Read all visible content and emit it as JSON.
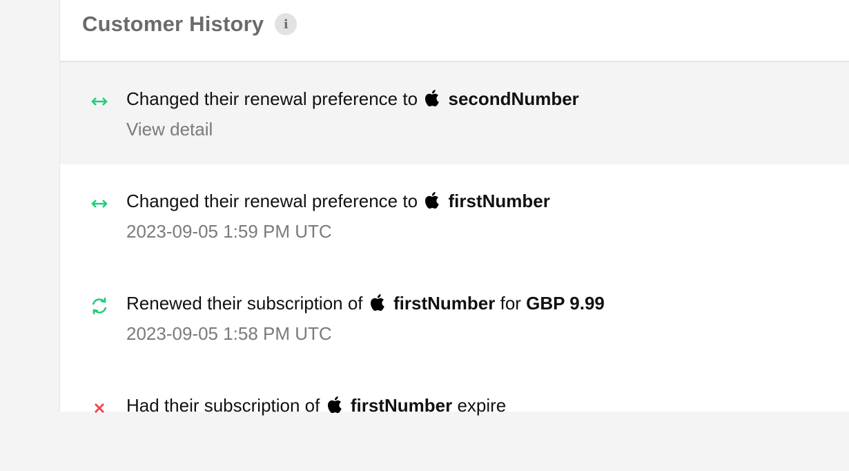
{
  "header": {
    "title": "Customer History",
    "info_glyph": "i"
  },
  "colors": {
    "green": "#1fce7a",
    "red": "#e8464e",
    "selected_bg": "#f4f4f4"
  },
  "events": [
    {
      "icon": "swap-horizontal-icon",
      "prefix": "Changed their renewal preference to",
      "product": "secondNumber",
      "suffix": "",
      "sub": "View detail",
      "selected": true
    },
    {
      "icon": "swap-horizontal-icon",
      "prefix": "Changed their renewal preference to",
      "product": "firstNumber",
      "suffix": "",
      "sub": "2023-09-05 1:59 PM UTC"
    },
    {
      "icon": "renew-icon",
      "prefix": "Renewed their subscription of",
      "product": "firstNumber",
      "mid": "for",
      "amount": "GBP 9.99",
      "sub": "2023-09-05 1:58 PM UTC"
    },
    {
      "icon": "close-icon",
      "prefix": "Had their subscription of",
      "product": "firstNumber",
      "suffix": "expire",
      "sub": ""
    }
  ]
}
